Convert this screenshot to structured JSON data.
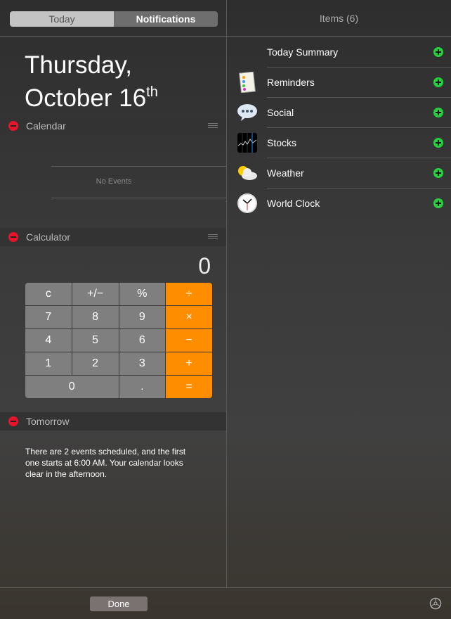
{
  "tabs": {
    "today": "Today",
    "notifications": "Notifications"
  },
  "date": {
    "line1": "Thursday,",
    "line2": "October 16",
    "suffix": "th"
  },
  "calendar": {
    "title": "Calendar",
    "empty": "No Events"
  },
  "calculator": {
    "title": "Calculator",
    "display": "0",
    "keys": [
      "c",
      "+/−",
      "%",
      "÷",
      "7",
      "8",
      "9",
      "×",
      "4",
      "5",
      "6",
      "−",
      "1",
      "2",
      "3",
      "+",
      "0",
      ".",
      "="
    ]
  },
  "tomorrow": {
    "title": "Tomorrow",
    "text": "There are 2 events scheduled, and the first one starts at 6:00 AM. Your calendar looks clear in the afternoon."
  },
  "items": {
    "header": "Items (6)",
    "list": [
      {
        "label": "Today Summary",
        "icon": "none"
      },
      {
        "label": "Reminders",
        "icon": "reminders-icon"
      },
      {
        "label": "Social",
        "icon": "speech-bubble-icon"
      },
      {
        "label": "Stocks",
        "icon": "stocks-chart-icon"
      },
      {
        "label": "Weather",
        "icon": "sun-cloud-icon"
      },
      {
        "label": "World Clock",
        "icon": "clock-icon"
      }
    ]
  },
  "footer": {
    "done": "Done"
  },
  "colors": {
    "accent_orange": "#fe8d00",
    "remove_red": "#e8142b",
    "add_green": "#22d33a"
  }
}
